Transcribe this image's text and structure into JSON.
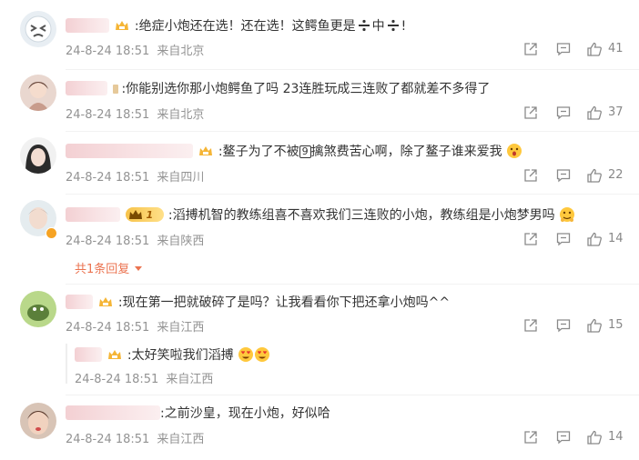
{
  "comments": [
    {
      "text": ":绝症小炮还在选！还在选！这鳄鱼更是",
      "text_tail": "中",
      "text_end": "!",
      "time": "24-8-24 18:51",
      "location": "来自北京",
      "likes": "41"
    },
    {
      "text": ":你能别选你那小炮鳄鱼了吗 23连胜玩成三连败了都就差不多得了",
      "time": "24-8-24 18:51",
      "location": "来自北京",
      "likes": "37"
    },
    {
      "text": ":鳌子为了不被",
      "text_tail": "擒煞费苦心啊，除了鳌子谁来爱我",
      "boxed_char": "9",
      "time": "24-8-24 18:51",
      "location": "来自四川",
      "likes": "22"
    },
    {
      "text": ":滔搏机智的教练组喜不喜欢我们三连败的小炮，教练组是小炮梦男吗",
      "vip_level": "1",
      "time": "24-8-24 18:51",
      "location": "来自陕西",
      "likes": "14",
      "replies_link": "共1条回复"
    },
    {
      "text": ":现在第一把就破碎了是吗？让我看看你下把还拿小炮吗^^",
      "time": "24-8-24 18:51",
      "location": "来自江西",
      "likes": "15",
      "reply": {
        "text": ":太好笑啦我们滔搏",
        "time": "24-8-24 18:51",
        "location": "来自江西"
      }
    },
    {
      "text": ":之前沙皇，现在小炮，好似哈",
      "time": "24-8-24 18:51",
      "location": "来自江西",
      "likes": "14"
    }
  ],
  "icons": {
    "share": "share-icon",
    "comment": "comment-icon",
    "like": "thumbs-up-icon"
  },
  "colors": {
    "meta": "#939393",
    "link": "#eb7350",
    "name_blur": "#f3d0d3"
  }
}
